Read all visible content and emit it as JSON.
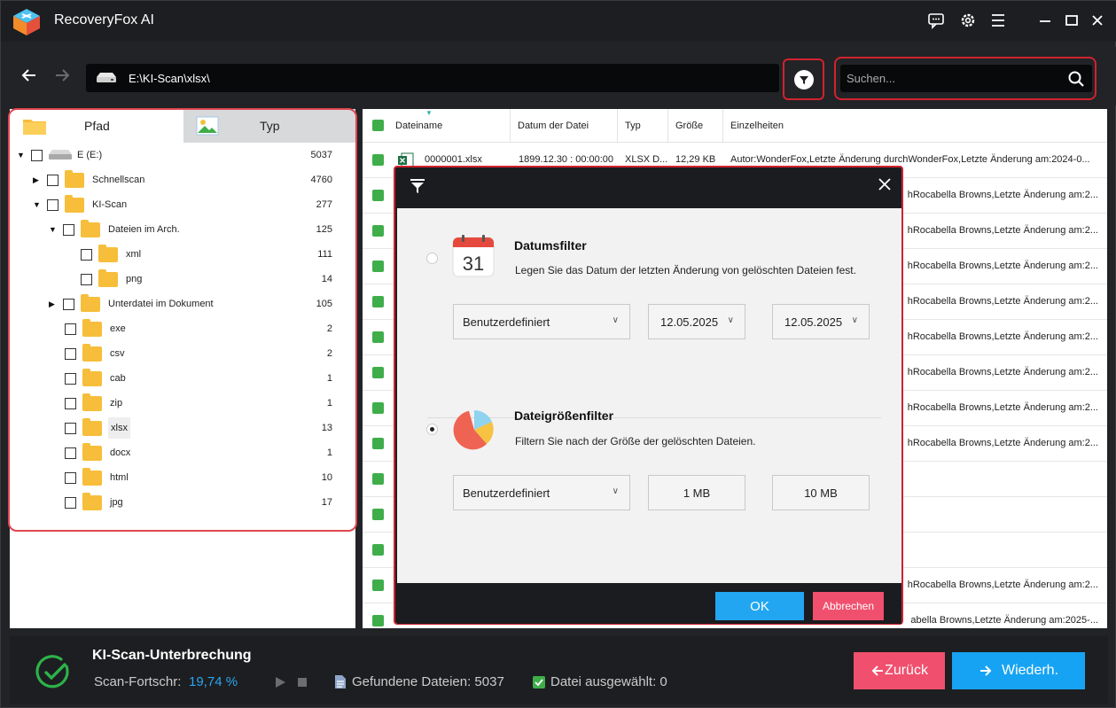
{
  "app": {
    "title": "RecoveryFox AI"
  },
  "titlebar": {
    "icons": [
      "feedback-icon",
      "settings-icon",
      "menu-icon",
      "minimize-icon",
      "maximize-icon",
      "close-icon"
    ]
  },
  "nav": {
    "path": "E:\\KI-Scan\\xlsx\\",
    "search_placeholder": "Suchen..."
  },
  "left": {
    "tabs": [
      {
        "label": "Pfad"
      },
      {
        "label": "Typ"
      }
    ],
    "tree": [
      {
        "label": "E (E:)",
        "count": "5037"
      },
      {
        "label": "Schnellscan",
        "count": "4760"
      },
      {
        "label": "KI-Scan",
        "count": "277"
      },
      {
        "label": "Dateien im Arch.",
        "count": "125"
      },
      {
        "label": "xml",
        "count": "111"
      },
      {
        "label": "png",
        "count": "14"
      },
      {
        "label": "Unterdatei im Dokument",
        "count": "105"
      },
      {
        "label": "exe",
        "count": "2"
      },
      {
        "label": "csv",
        "count": "2"
      },
      {
        "label": "cab",
        "count": "1"
      },
      {
        "label": "zip",
        "count": "1"
      },
      {
        "label": "xlsx",
        "count": "13"
      },
      {
        "label": "docx",
        "count": "1"
      },
      {
        "label": "html",
        "count": "10"
      },
      {
        "label": "jpg",
        "count": "17"
      }
    ]
  },
  "list": {
    "headers": [
      "Dateiname",
      "Datum der Datei",
      "Typ",
      "Größe",
      "Einzelheiten"
    ],
    "first_row": {
      "name": "0000001.xlsx",
      "date": "1899.12.30 : 00:00:00",
      "type": "XLSX D...",
      "size": "12,29 KB",
      "details": "Autor:WonderFox,Letzte Änderung durchWonderFox,Letzte Änderung am:2024-0..."
    },
    "rows": [
      "hRocabella Browns,Letzte Änderung am:2...",
      "hRocabella Browns,Letzte Änderung am:2...",
      "hRocabella Browns,Letzte Änderung am:2...",
      "hRocabella Browns,Letzte Änderung am:2...",
      "hRocabella Browns,Letzte Änderung am:2...",
      "hRocabella Browns,Letzte Änderung am:2...",
      "hRocabella Browns,Letzte Änderung am:2...",
      "hRocabella Browns,Letzte Änderung am:2...",
      "",
      "",
      "",
      "hRocabella Browns,Letzte Änderung am:2...",
      "abella Browns,Letzte Änderung am:2025-..."
    ]
  },
  "dialog": {
    "date_filter": {
      "calendar_day": "31",
      "title": "Datumsfilter",
      "desc": "Legen Sie das Datum der letzten Änderung von gelöschten Dateien fest.",
      "preset": "Benutzerdefiniert",
      "from": "12.05.2025",
      "to": "12.05.2025"
    },
    "size_filter": {
      "title": "Dateigrößenfilter",
      "desc": "Filtern Sie nach der Größe der gelöschten Dateien.",
      "preset": "Benutzerdefiniert",
      "min": "1 MB",
      "max": "10 MB"
    },
    "ok_label": "OK",
    "cancel_label": "Abbrechen"
  },
  "bottom": {
    "status_title": "KI-Scan-Unterbrechung",
    "progress_label": "Scan-Fortschr:",
    "progress_value": "19,74 %",
    "found_label": "Gefundene Dateien: 5037",
    "selected_label": "Datei ausgewählt: 0",
    "back_label": "Zurück",
    "resume_label": "Wiederh."
  },
  "colors": {
    "accent": "#17a3f3",
    "danger": "#f0506e",
    "success": "#3fae4a",
    "highlight": "#d0232f"
  }
}
